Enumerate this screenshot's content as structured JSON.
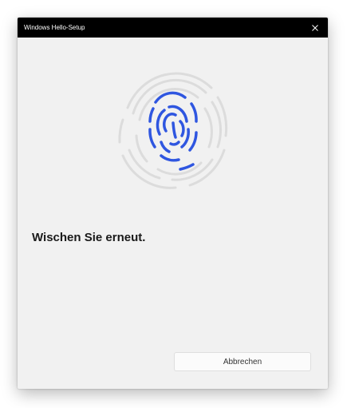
{
  "window": {
    "title": "Windows Hello-Setup",
    "close_icon": "close-icon"
  },
  "main": {
    "illustration_icon": "fingerprint-icon",
    "message": "Wischen Sie erneut.",
    "cancel_label": "Abbrechen"
  },
  "colors": {
    "titlebar": "#000000",
    "window_background": "#f1f1f1",
    "fingerprint_active": "#2f56e0",
    "fingerprint_inactive": "#dcdcdc"
  }
}
